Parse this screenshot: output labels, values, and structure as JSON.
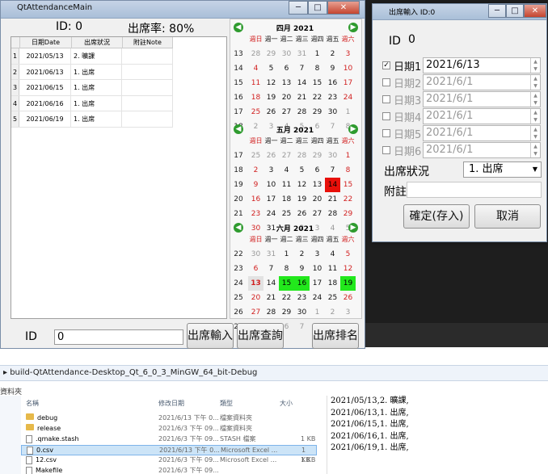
{
  "main_window": {
    "title": "QtAttendanceMain",
    "id_label": "ID: 0",
    "rate_label": "出席率: 80%",
    "columns": [
      "日期Date",
      "出席狀況",
      "附註Note"
    ],
    "rows": [
      {
        "num": "1",
        "date": "2021/05/13",
        "status": "2. 曠課"
      },
      {
        "num": "2",
        "date": "2021/06/13",
        "status": "1. 出席"
      },
      {
        "num": "3",
        "date": "2021/06/15",
        "status": "1. 出席"
      },
      {
        "num": "4",
        "date": "2021/06/16",
        "status": "1. 出席"
      },
      {
        "num": "5",
        "date": "2021/06/19",
        "status": "1. 出席"
      }
    ],
    "id_field_label": "ID",
    "id_value": "0",
    "btn_input": "出席輸入",
    "btn_query": "出席查詢",
    "btn_rank": "出席排名"
  },
  "calendars": [
    {
      "month": "四月",
      "year": "2021",
      "weeks": [
        [
          "13",
          "28",
          "29",
          "30",
          "31",
          "1",
          "2",
          "3"
        ],
        [
          "14",
          "4",
          "5",
          "6",
          "7",
          "8",
          "9",
          "10"
        ],
        [
          "15",
          "11",
          "12",
          "13",
          "14",
          "15",
          "16",
          "17"
        ],
        [
          "16",
          "18",
          "19",
          "20",
          "21",
          "22",
          "23",
          "24"
        ],
        [
          "17",
          "25",
          "26",
          "27",
          "28",
          "29",
          "30",
          "1"
        ],
        [
          "18",
          "2",
          "3",
          "4",
          "5",
          "6",
          "7",
          "8"
        ]
      ]
    },
    {
      "month": "五月",
      "year": "2021",
      "weeks": [
        [
          "17",
          "25",
          "26",
          "27",
          "28",
          "29",
          "30",
          "1"
        ],
        [
          "18",
          "2",
          "3",
          "4",
          "5",
          "6",
          "7",
          "8"
        ],
        [
          "19",
          "9",
          "10",
          "11",
          "12",
          "13",
          "14",
          "15"
        ],
        [
          "20",
          "16",
          "17",
          "18",
          "19",
          "20",
          "21",
          "22"
        ],
        [
          "21",
          "23",
          "24",
          "25",
          "26",
          "27",
          "28",
          "29"
        ],
        [
          "22",
          "30",
          "31",
          "1",
          "2",
          "3",
          "4",
          "5"
        ]
      ]
    },
    {
      "month": "六月",
      "year": "2021",
      "weeks": [
        [
          "22",
          "30",
          "31",
          "1",
          "2",
          "3",
          "4",
          "5"
        ],
        [
          "23",
          "6",
          "7",
          "8",
          "9",
          "10",
          "11",
          "12"
        ],
        [
          "24",
          "13",
          "14",
          "15",
          "16",
          "17",
          "18",
          "19"
        ],
        [
          "25",
          "20",
          "21",
          "22",
          "23",
          "24",
          "25",
          "26"
        ],
        [
          "26",
          "27",
          "28",
          "29",
          "30",
          "1",
          "2",
          "3"
        ],
        [
          "27",
          "4",
          "5",
          "6",
          "7",
          "8",
          "9",
          "10"
        ]
      ]
    }
  ],
  "weekdays": [
    "週日",
    "週一",
    "週二",
    "週三",
    "週四",
    "週五",
    "週六"
  ],
  "dialog": {
    "title": "出席輸入 ID:0",
    "id_label": "ID",
    "id_value": "0",
    "dates": [
      {
        "label": "日期1",
        "value": "2021/6/13",
        "checked": true
      },
      {
        "label": "日期2",
        "value": "2021/6/1",
        "checked": false
      },
      {
        "label": "日期3",
        "value": "2021/6/1",
        "checked": false
      },
      {
        "label": "日期4",
        "value": "2021/6/1",
        "checked": false
      },
      {
        "label": "日期5",
        "value": "2021/6/1",
        "checked": false
      },
      {
        "label": "日期6",
        "value": "2021/6/1",
        "checked": false
      }
    ],
    "status_label": "出席狀況",
    "status_value": "1. 出席",
    "note_label": "附註",
    "confirm": "確定(存入)",
    "cancel": "取消"
  },
  "explorer": {
    "path": "build-QtAttendance-Desktop_Qt_6_0_3_MinGW_64_bit-Debug",
    "folder_label": "資料夾",
    "headers": [
      "名稱",
      "修改日期",
      "類型",
      "大小"
    ],
    "files": [
      {
        "name": "debug",
        "date": "2021/6/13 下午 0...",
        "type": "檔案資料夾",
        "size": ""
      },
      {
        "name": "release",
        "date": "2021/6/3 下午 09...",
        "type": "檔案資料夾",
        "size": ""
      },
      {
        "name": ".qmake.stash",
        "date": "2021/6/3 下午 09...",
        "type": "STASH 檔案",
        "size": "1 KB"
      },
      {
        "name": "0.csv",
        "date": "2021/6/13 下午 0...",
        "type": "Microsoft Excel ...",
        "size": "1 KB"
      },
      {
        "name": "12.csv",
        "date": "2021/6/3 下午 09...",
        "type": "Microsoft Excel ...",
        "size": "1 KB"
      },
      {
        "name": "Makefile",
        "date": "2021/6/3 下午 09...",
        "type": "",
        "size": ""
      }
    ]
  },
  "csv_lines": [
    "2021/05/13,2. 曠課,",
    "2021/06/13,1. 出席,",
    "2021/06/15,1. 出席,",
    "2021/06/16,1. 出席,",
    "2021/06/19,1. 出席,"
  ],
  "colors": {
    "red_mark": "#e8100a",
    "green_mark": "#22e81c",
    "weekend": "#d11f1f"
  }
}
